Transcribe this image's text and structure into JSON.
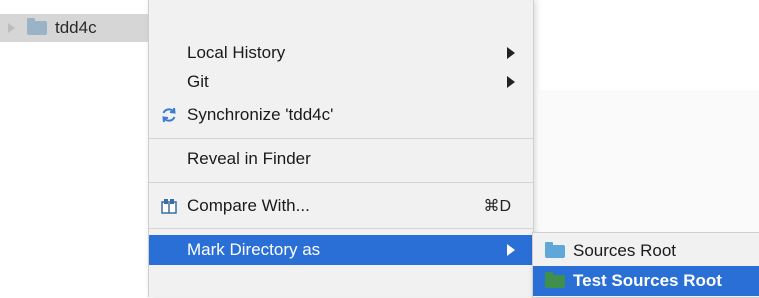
{
  "tree": {
    "item_label": "tdd4c"
  },
  "menu": {
    "items": [
      {
        "label": "Local History",
        "submenu": true
      },
      {
        "label": "Git",
        "submenu": true
      },
      {
        "label": "Synchronize 'tdd4c'",
        "icon": "sync-icon"
      },
      {
        "label": "Reveal in Finder"
      },
      {
        "label": "Compare With...",
        "icon": "compare-icon",
        "shortcut": "⌘D"
      },
      {
        "label": "Mark Directory as",
        "submenu": true,
        "highlighted": true
      }
    ]
  },
  "submenu": {
    "items": [
      {
        "label": "Sources Root",
        "icon": "folder-blue-icon",
        "color": "#5ea7d8"
      },
      {
        "label": "Test Sources Root",
        "icon": "folder-green-icon",
        "color": "#3f8f4d",
        "highlighted": true
      }
    ]
  },
  "colors": {
    "highlight": "#2a6fd6",
    "menu_bg": "#f1f1f1"
  }
}
